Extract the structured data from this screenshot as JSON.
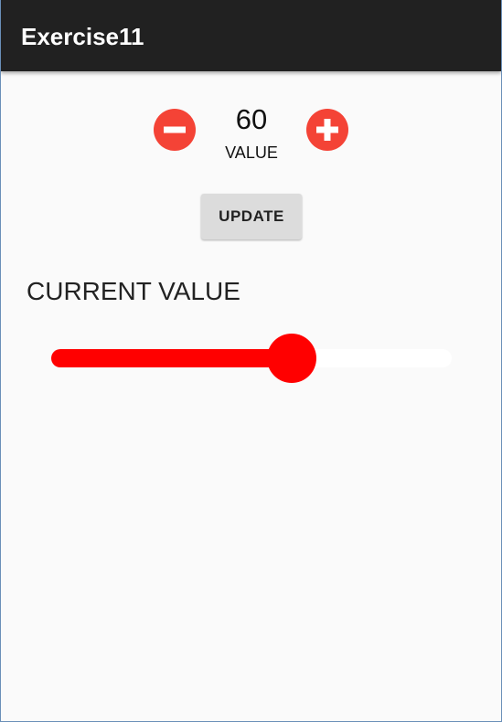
{
  "app_bar": {
    "title": "Exercise11",
    "background_color": "#212121"
  },
  "stepper": {
    "decrement_icon": "minus-circle-icon",
    "increment_icon": "plus-circle-icon",
    "icon_color": "#f44336",
    "value": "60",
    "caption": "VALUE"
  },
  "update_button": {
    "label": "UPDATE"
  },
  "current_value": {
    "label": "CURRENT VALUE"
  },
  "slider": {
    "level_fraction": 0.6,
    "accent_color": "#ff0000"
  }
}
